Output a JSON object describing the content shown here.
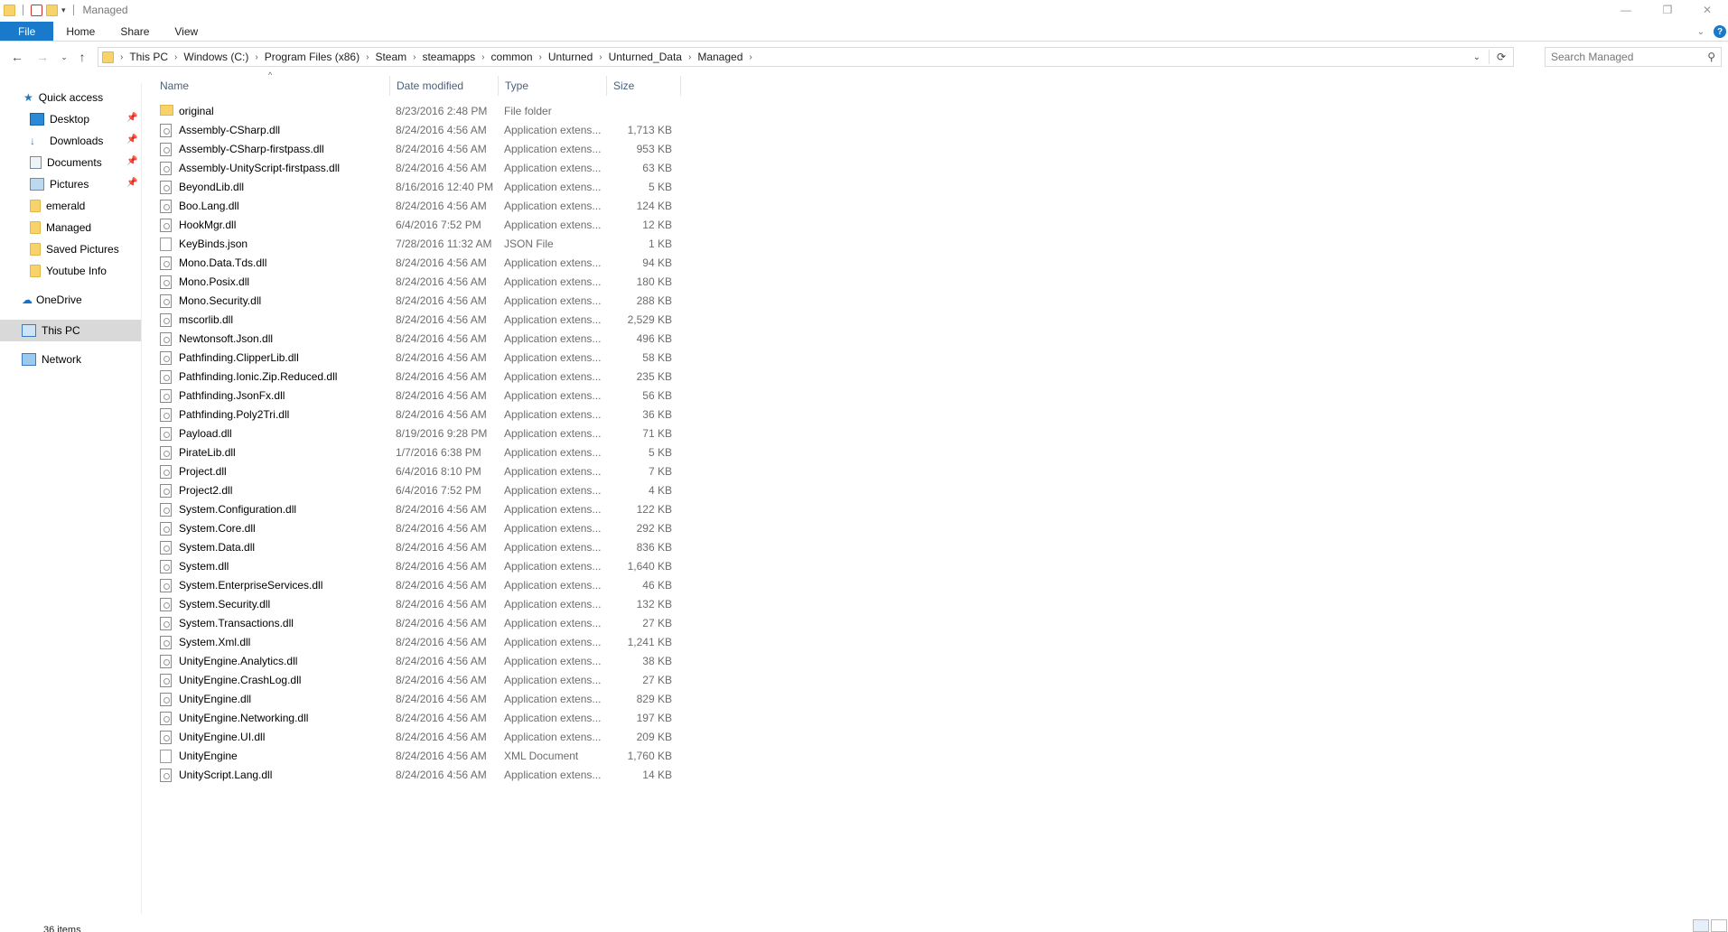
{
  "window": {
    "title": "Managed",
    "controls": {
      "minimize": "—",
      "maximize": "❐",
      "close": "✕"
    }
  },
  "ribbon": {
    "tabs": [
      "File",
      "Home",
      "Share",
      "View"
    ]
  },
  "address": {
    "crumbs": [
      "This PC",
      "Windows (C:)",
      "Program Files (x86)",
      "Steam",
      "steamapps",
      "common",
      "Unturned",
      "Unturned_Data",
      "Managed"
    ],
    "search_placeholder": "Search Managed"
  },
  "nav": {
    "quick_access": "Quick access",
    "pinned": [
      "Desktop",
      "Downloads",
      "Documents",
      "Pictures"
    ],
    "folders": [
      "emerald",
      "Managed",
      "Saved Pictures",
      "Youtube Info"
    ],
    "onedrive": "OneDrive",
    "this_pc": "This PC",
    "network": "Network"
  },
  "columns": {
    "name": "Name",
    "date": "Date modified",
    "type": "Type",
    "size": "Size"
  },
  "files": [
    {
      "name": "original",
      "date": "8/23/2016 2:48 PM",
      "type": "File folder",
      "size": "",
      "kind": "folder"
    },
    {
      "name": "Assembly-CSharp.dll",
      "date": "8/24/2016 4:56 AM",
      "type": "Application extens...",
      "size": "1,713 KB",
      "kind": "dll"
    },
    {
      "name": "Assembly-CSharp-firstpass.dll",
      "date": "8/24/2016 4:56 AM",
      "type": "Application extens...",
      "size": "953 KB",
      "kind": "dll"
    },
    {
      "name": "Assembly-UnityScript-firstpass.dll",
      "date": "8/24/2016 4:56 AM",
      "type": "Application extens...",
      "size": "63 KB",
      "kind": "dll"
    },
    {
      "name": "BeyondLib.dll",
      "date": "8/16/2016 12:40 PM",
      "type": "Application extens...",
      "size": "5 KB",
      "kind": "dll"
    },
    {
      "name": "Boo.Lang.dll",
      "date": "8/24/2016 4:56 AM",
      "type": "Application extens...",
      "size": "124 KB",
      "kind": "dll"
    },
    {
      "name": "HookMgr.dll",
      "date": "6/4/2016 7:52 PM",
      "type": "Application extens...",
      "size": "12 KB",
      "kind": "dll"
    },
    {
      "name": "KeyBinds.json",
      "date": "7/28/2016 11:32 AM",
      "type": "JSON File",
      "size": "1 KB",
      "kind": "json"
    },
    {
      "name": "Mono.Data.Tds.dll",
      "date": "8/24/2016 4:56 AM",
      "type": "Application extens...",
      "size": "94 KB",
      "kind": "dll"
    },
    {
      "name": "Mono.Posix.dll",
      "date": "8/24/2016 4:56 AM",
      "type": "Application extens...",
      "size": "180 KB",
      "kind": "dll"
    },
    {
      "name": "Mono.Security.dll",
      "date": "8/24/2016 4:56 AM",
      "type": "Application extens...",
      "size": "288 KB",
      "kind": "dll"
    },
    {
      "name": "mscorlib.dll",
      "date": "8/24/2016 4:56 AM",
      "type": "Application extens...",
      "size": "2,529 KB",
      "kind": "dll"
    },
    {
      "name": "Newtonsoft.Json.dll",
      "date": "8/24/2016 4:56 AM",
      "type": "Application extens...",
      "size": "496 KB",
      "kind": "dll"
    },
    {
      "name": "Pathfinding.ClipperLib.dll",
      "date": "8/24/2016 4:56 AM",
      "type": "Application extens...",
      "size": "58 KB",
      "kind": "dll"
    },
    {
      "name": "Pathfinding.Ionic.Zip.Reduced.dll",
      "date": "8/24/2016 4:56 AM",
      "type": "Application extens...",
      "size": "235 KB",
      "kind": "dll"
    },
    {
      "name": "Pathfinding.JsonFx.dll",
      "date": "8/24/2016 4:56 AM",
      "type": "Application extens...",
      "size": "56 KB",
      "kind": "dll"
    },
    {
      "name": "Pathfinding.Poly2Tri.dll",
      "date": "8/24/2016 4:56 AM",
      "type": "Application extens...",
      "size": "36 KB",
      "kind": "dll"
    },
    {
      "name": "Payload.dll",
      "date": "8/19/2016 9:28 PM",
      "type": "Application extens...",
      "size": "71 KB",
      "kind": "dll"
    },
    {
      "name": "PirateLib.dll",
      "date": "1/7/2016 6:38 PM",
      "type": "Application extens...",
      "size": "5 KB",
      "kind": "dll"
    },
    {
      "name": "Project.dll",
      "date": "6/4/2016 8:10 PM",
      "type": "Application extens...",
      "size": "7 KB",
      "kind": "dll"
    },
    {
      "name": "Project2.dll",
      "date": "6/4/2016 7:52 PM",
      "type": "Application extens...",
      "size": "4 KB",
      "kind": "dll"
    },
    {
      "name": "System.Configuration.dll",
      "date": "8/24/2016 4:56 AM",
      "type": "Application extens...",
      "size": "122 KB",
      "kind": "dll"
    },
    {
      "name": "System.Core.dll",
      "date": "8/24/2016 4:56 AM",
      "type": "Application extens...",
      "size": "292 KB",
      "kind": "dll"
    },
    {
      "name": "System.Data.dll",
      "date": "8/24/2016 4:56 AM",
      "type": "Application extens...",
      "size": "836 KB",
      "kind": "dll"
    },
    {
      "name": "System.dll",
      "date": "8/24/2016 4:56 AM",
      "type": "Application extens...",
      "size": "1,640 KB",
      "kind": "dll"
    },
    {
      "name": "System.EnterpriseServices.dll",
      "date": "8/24/2016 4:56 AM",
      "type": "Application extens...",
      "size": "46 KB",
      "kind": "dll"
    },
    {
      "name": "System.Security.dll",
      "date": "8/24/2016 4:56 AM",
      "type": "Application extens...",
      "size": "132 KB",
      "kind": "dll"
    },
    {
      "name": "System.Transactions.dll",
      "date": "8/24/2016 4:56 AM",
      "type": "Application extens...",
      "size": "27 KB",
      "kind": "dll"
    },
    {
      "name": "System.Xml.dll",
      "date": "8/24/2016 4:56 AM",
      "type": "Application extens...",
      "size": "1,241 KB",
      "kind": "dll"
    },
    {
      "name": "UnityEngine.Analytics.dll",
      "date": "8/24/2016 4:56 AM",
      "type": "Application extens...",
      "size": "38 KB",
      "kind": "dll"
    },
    {
      "name": "UnityEngine.CrashLog.dll",
      "date": "8/24/2016 4:56 AM",
      "type": "Application extens...",
      "size": "27 KB",
      "kind": "dll"
    },
    {
      "name": "UnityEngine.dll",
      "date": "8/24/2016 4:56 AM",
      "type": "Application extens...",
      "size": "829 KB",
      "kind": "dll"
    },
    {
      "name": "UnityEngine.Networking.dll",
      "date": "8/24/2016 4:56 AM",
      "type": "Application extens...",
      "size": "197 KB",
      "kind": "dll"
    },
    {
      "name": "UnityEngine.UI.dll",
      "date": "8/24/2016 4:56 AM",
      "type": "Application extens...",
      "size": "209 KB",
      "kind": "dll"
    },
    {
      "name": "UnityEngine",
      "date": "8/24/2016 4:56 AM",
      "type": "XML Document",
      "size": "1,760 KB",
      "kind": "xml"
    },
    {
      "name": "UnityScript.Lang.dll",
      "date": "8/24/2016 4:56 AM",
      "type": "Application extens...",
      "size": "14 KB",
      "kind": "dll"
    }
  ],
  "status": {
    "count": "36 items"
  }
}
